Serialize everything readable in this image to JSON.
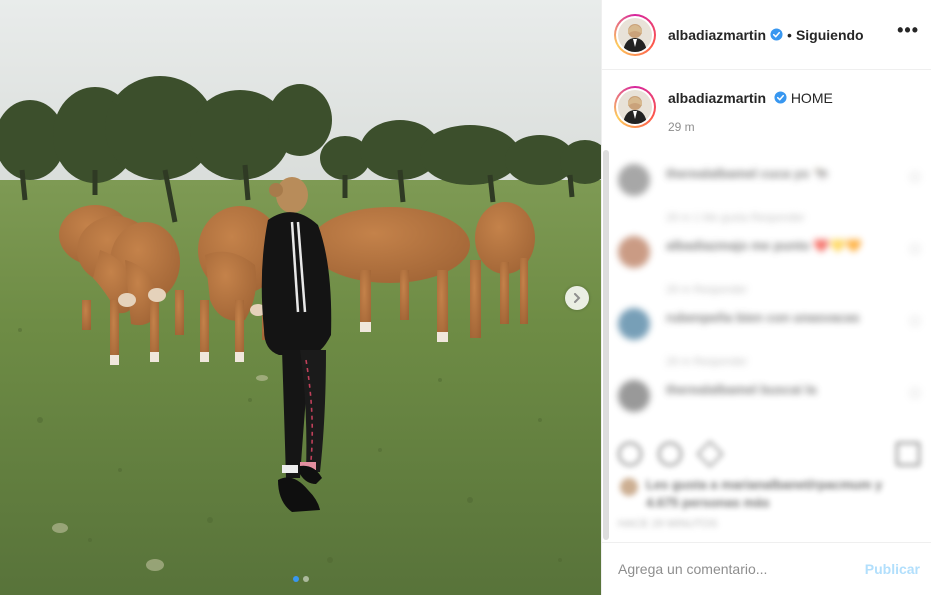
{
  "post": {
    "image_alt": "",
    "carousel": {
      "dots": 2,
      "active_index": 0
    }
  },
  "header": {
    "username": "albadiazmartin",
    "separator": "•",
    "follow_status": "Siguiendo",
    "more_icon": "more-options-icon",
    "more_label": "•••"
  },
  "caption": {
    "username": "albadiazmartin",
    "text": "HOME",
    "time": "29 m"
  },
  "comments": [
    {
      "avatar_color": "#8a8a8a",
      "text": "therealalbamel cuca yo 🐄",
      "meta": "29 m    1 Me gusta    Responder"
    },
    {
      "avatar_color": "#b97a5c",
      "text": "albadiazmajo me punto ❤️💛🧡",
      "meta": "29 m    Responder"
    },
    {
      "avatar_color": "#4a7fa0",
      "text": "rubenpeña bien con unasvacas",
      "meta": "29 m    Responder"
    },
    {
      "avatar_color": "#777777",
      "text": "therealalbamel buscai la",
      "meta": ""
    }
  ],
  "likes": {
    "line1": "Les gusta a marianalbanet/rpacmum y",
    "line2": "4.675 personas más"
  },
  "date": "HACE 29 MINUTOS",
  "add_comment": {
    "placeholder": "Agrega un comentario...",
    "publish_label": "Publicar"
  },
  "colors": {
    "verified": "#3897f0",
    "publish_disabled": "#b2dffc",
    "carousel_active": "#3897f0"
  }
}
